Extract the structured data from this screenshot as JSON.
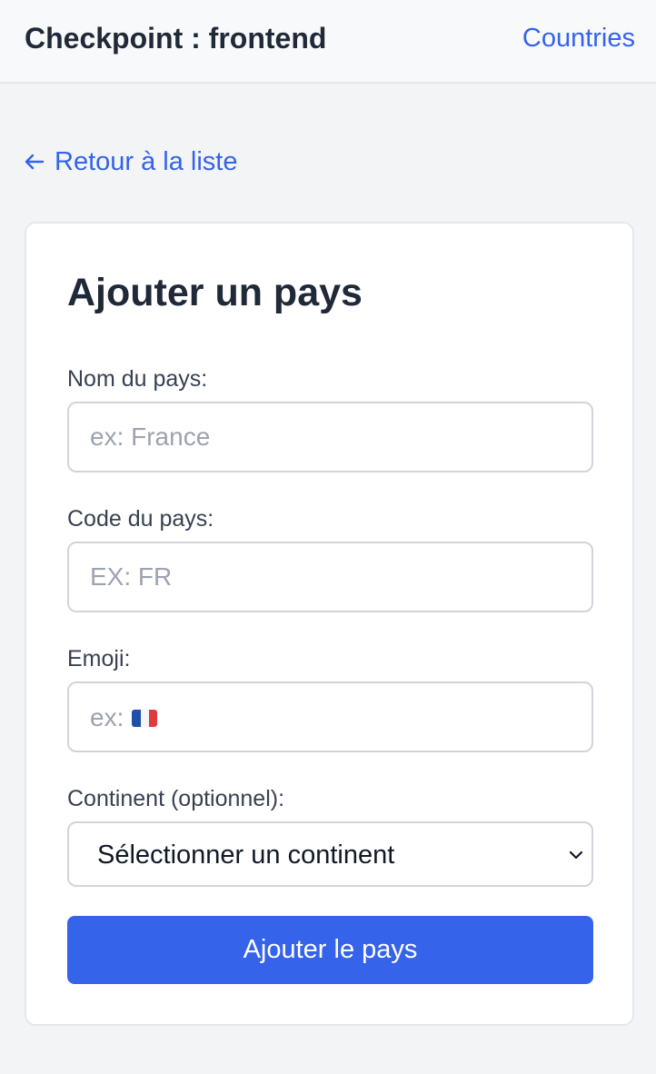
{
  "header": {
    "title": "Checkpoint : frontend",
    "nav_link": "Countries"
  },
  "back_link": {
    "label": "Retour à la liste"
  },
  "form": {
    "title": "Ajouter un pays",
    "name_field": {
      "label": "Nom du pays:",
      "placeholder": "ex: France",
      "value": ""
    },
    "code_field": {
      "label": "Code du pays:",
      "placeholder": "EX: FR",
      "value": ""
    },
    "emoji_field": {
      "label": "Emoji:",
      "placeholder": "ex:",
      "placeholder_flag": "french-flag-emoji",
      "value": ""
    },
    "continent_field": {
      "label": "Continent (optionnel):",
      "selected": "Sélectionner un continent"
    },
    "submit_label": "Ajouter le pays"
  },
  "colors": {
    "accent": "#3563e9",
    "page_background": "#f3f4f6",
    "card_background": "#ffffff",
    "text_dark": "#1f2937",
    "placeholder": "#9ca3af",
    "border": "#d1d5db"
  },
  "icons": {
    "back": "arrow-left-icon",
    "select": "chevron-down-icon"
  }
}
